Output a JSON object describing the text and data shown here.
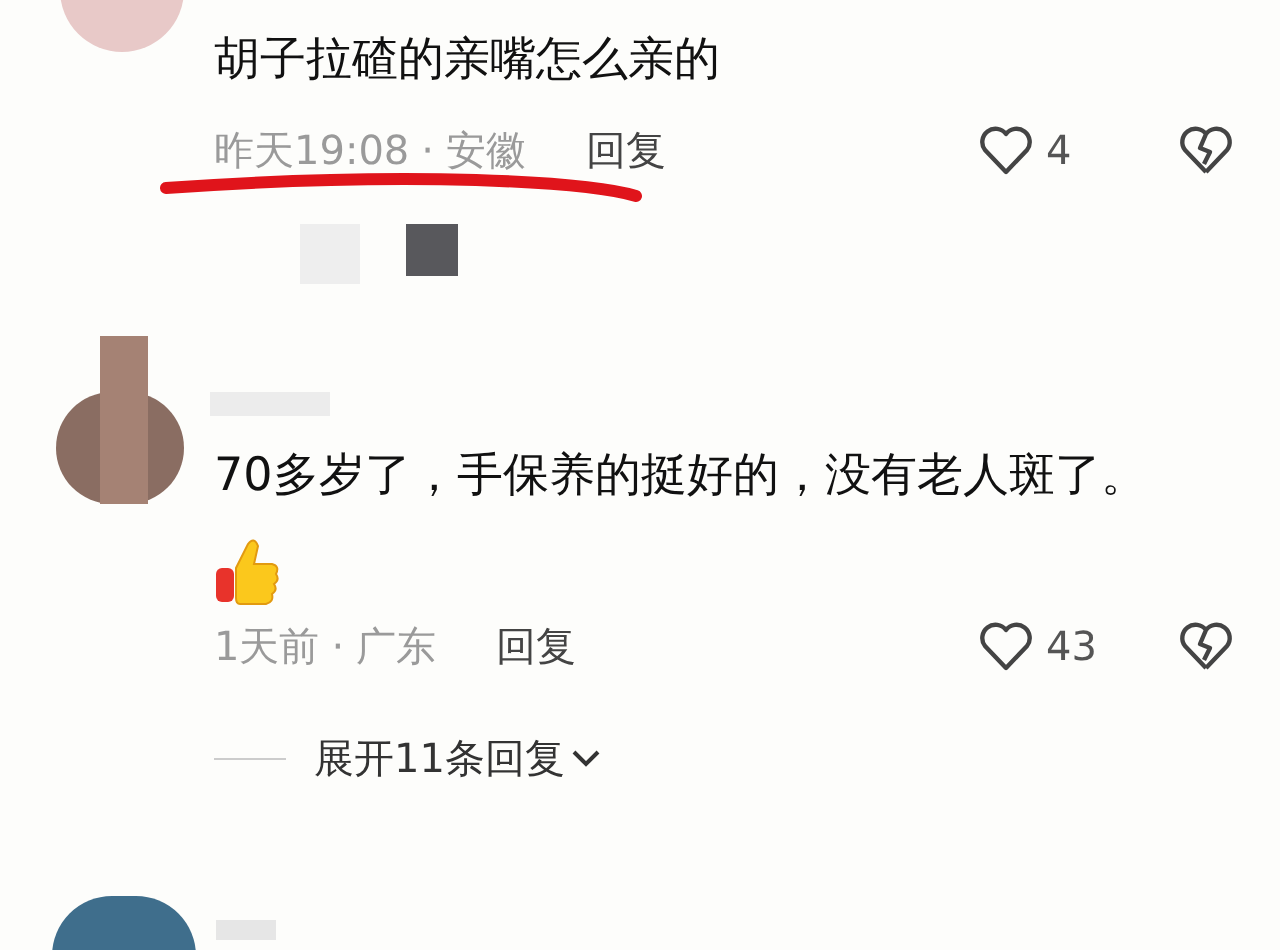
{
  "comments": [
    {
      "text": "胡子拉碴的亲嘴怎么亲的",
      "time": "昨天19:08",
      "location": "安徽",
      "separator": "·",
      "reply": "回复",
      "likes": "4",
      "annotated": true,
      "emoji": false
    },
    {
      "text": "70多岁了，手保养的挺好的，没有老人斑了。",
      "time": "1天前",
      "location": "广东",
      "separator": "·",
      "reply": "回复",
      "likes": "43",
      "annotated": false,
      "emoji": true,
      "expand_replies": "展开11条回复"
    }
  ]
}
